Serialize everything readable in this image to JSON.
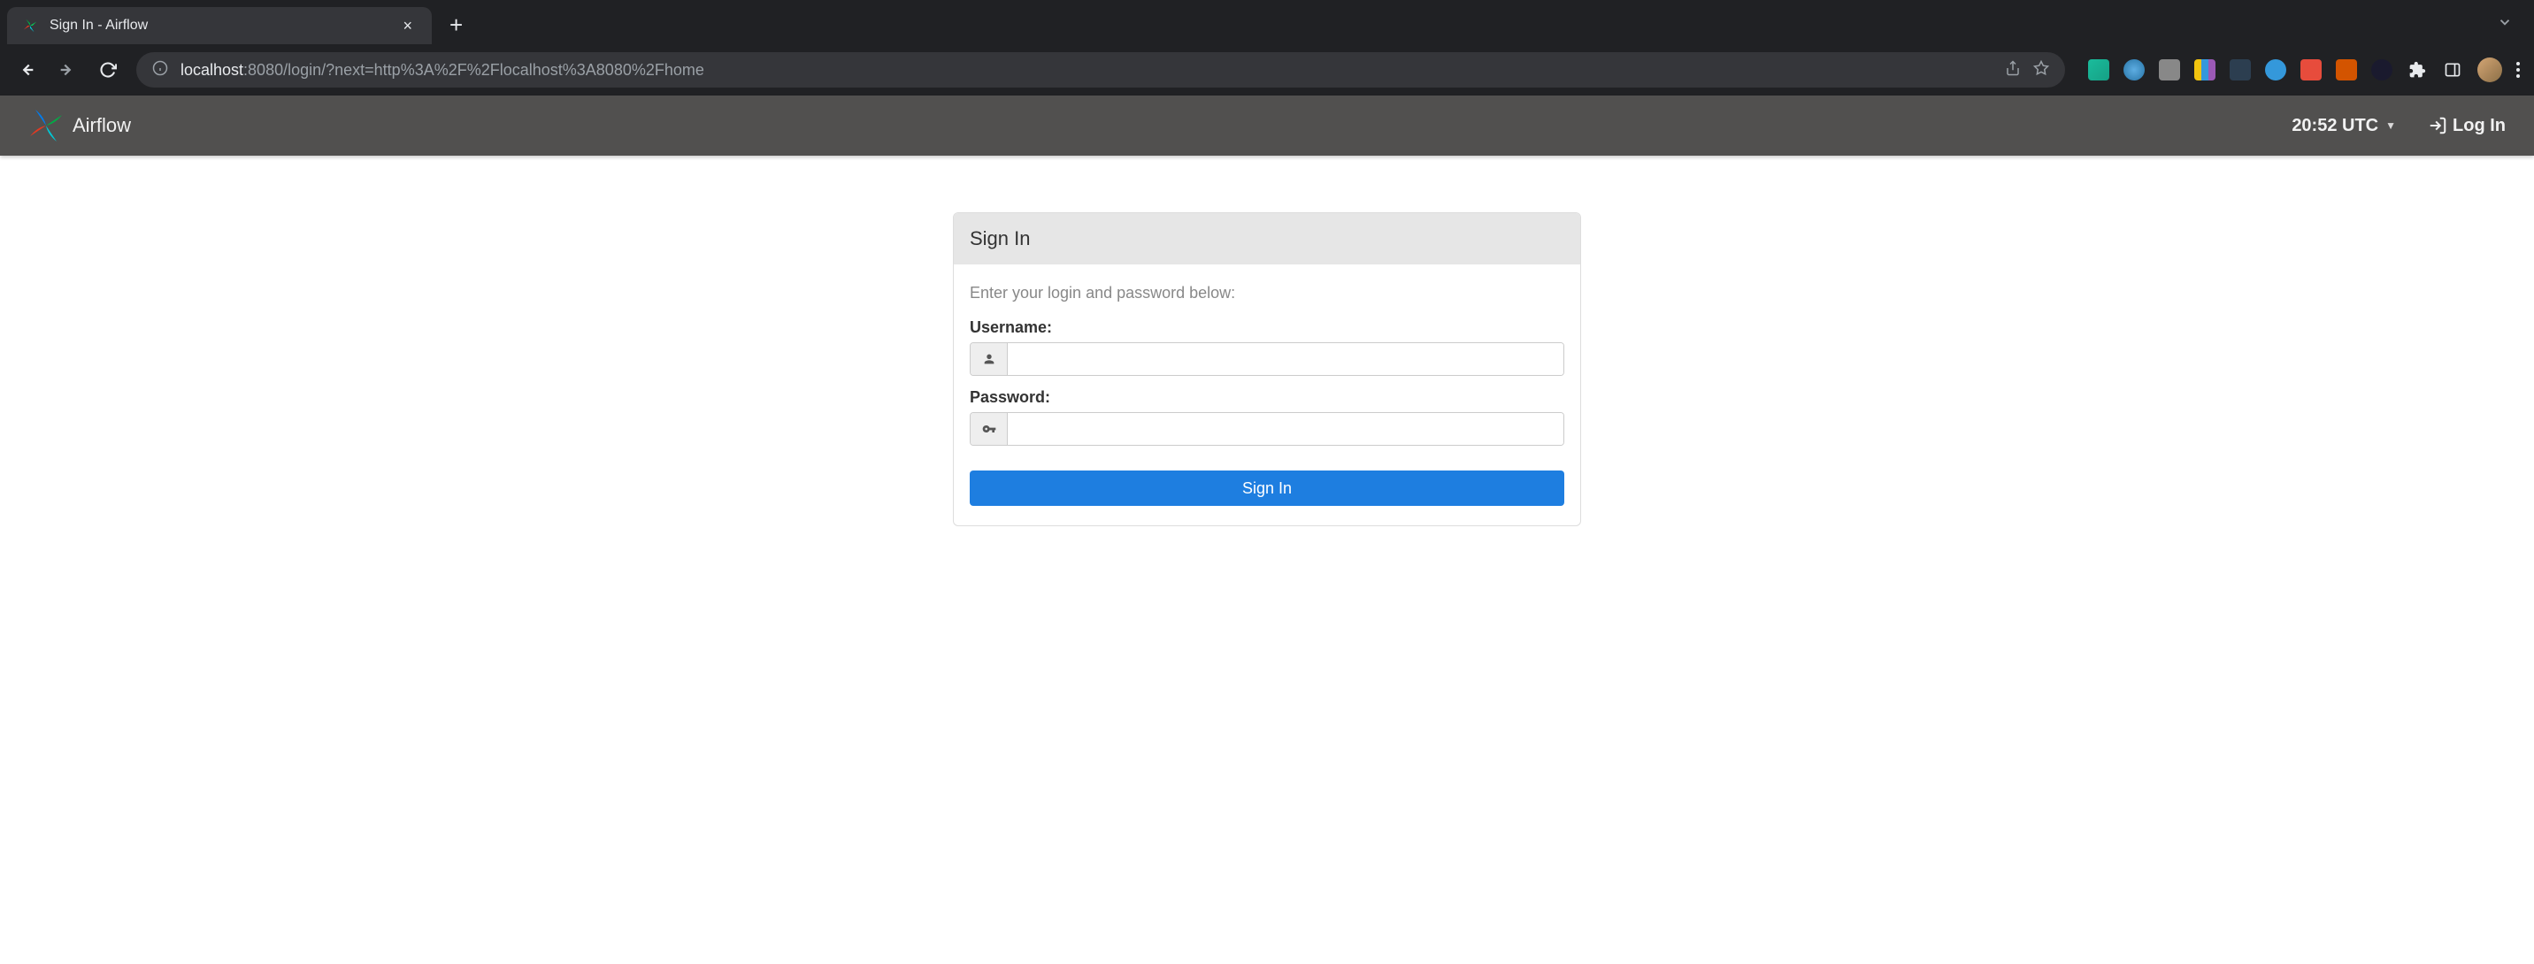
{
  "browser": {
    "tab_title": "Sign In - Airflow",
    "url_host": "localhost",
    "url_path": ":8080/login/?next=http%3A%2F%2Flocalhost%3A8080%2Fhome"
  },
  "header": {
    "brand": "Airflow",
    "time": "20:52 UTC",
    "login_label": "Log In"
  },
  "signin": {
    "panel_title": "Sign In",
    "help_text": "Enter your login and password below:",
    "username_label": "Username:",
    "password_label": "Password:",
    "username_value": "",
    "password_value": "",
    "submit_label": "Sign In"
  }
}
